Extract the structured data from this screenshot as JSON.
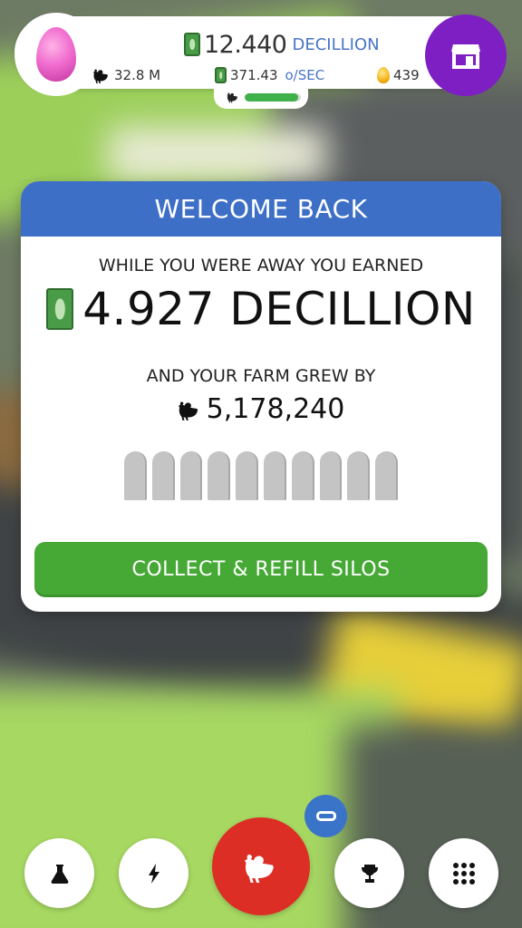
{
  "hud": {
    "money_value": "12.440",
    "money_unit": "DECILLION",
    "chickens": "32.8 M",
    "rate_value": "371.43",
    "rate_unit": "o/SEC",
    "golden_eggs": "439",
    "progress_fraction": 0.95
  },
  "dialog": {
    "title": "WELCOME BACK",
    "away_label": "WHILE YOU WERE AWAY YOU EARNED",
    "earned_value": "4.927 DECILLION",
    "grew_label": "AND YOUR FARM GREW BY",
    "grew_value": "5,178,240",
    "silo_count": 10,
    "collect_label": "COLLECT & REFILL SILOS"
  },
  "bottom_bar": {
    "icons": [
      "flask-icon",
      "lightning-icon",
      "chicken-icon",
      "trophy-icon",
      "grid-icon"
    ]
  },
  "colors": {
    "header_blue": "#3d6fc6",
    "button_green": "#46a935",
    "shop_purple": "#7d1fc2",
    "hatch_red": "#dc2e24",
    "unit_blue": "#4a74c7"
  }
}
